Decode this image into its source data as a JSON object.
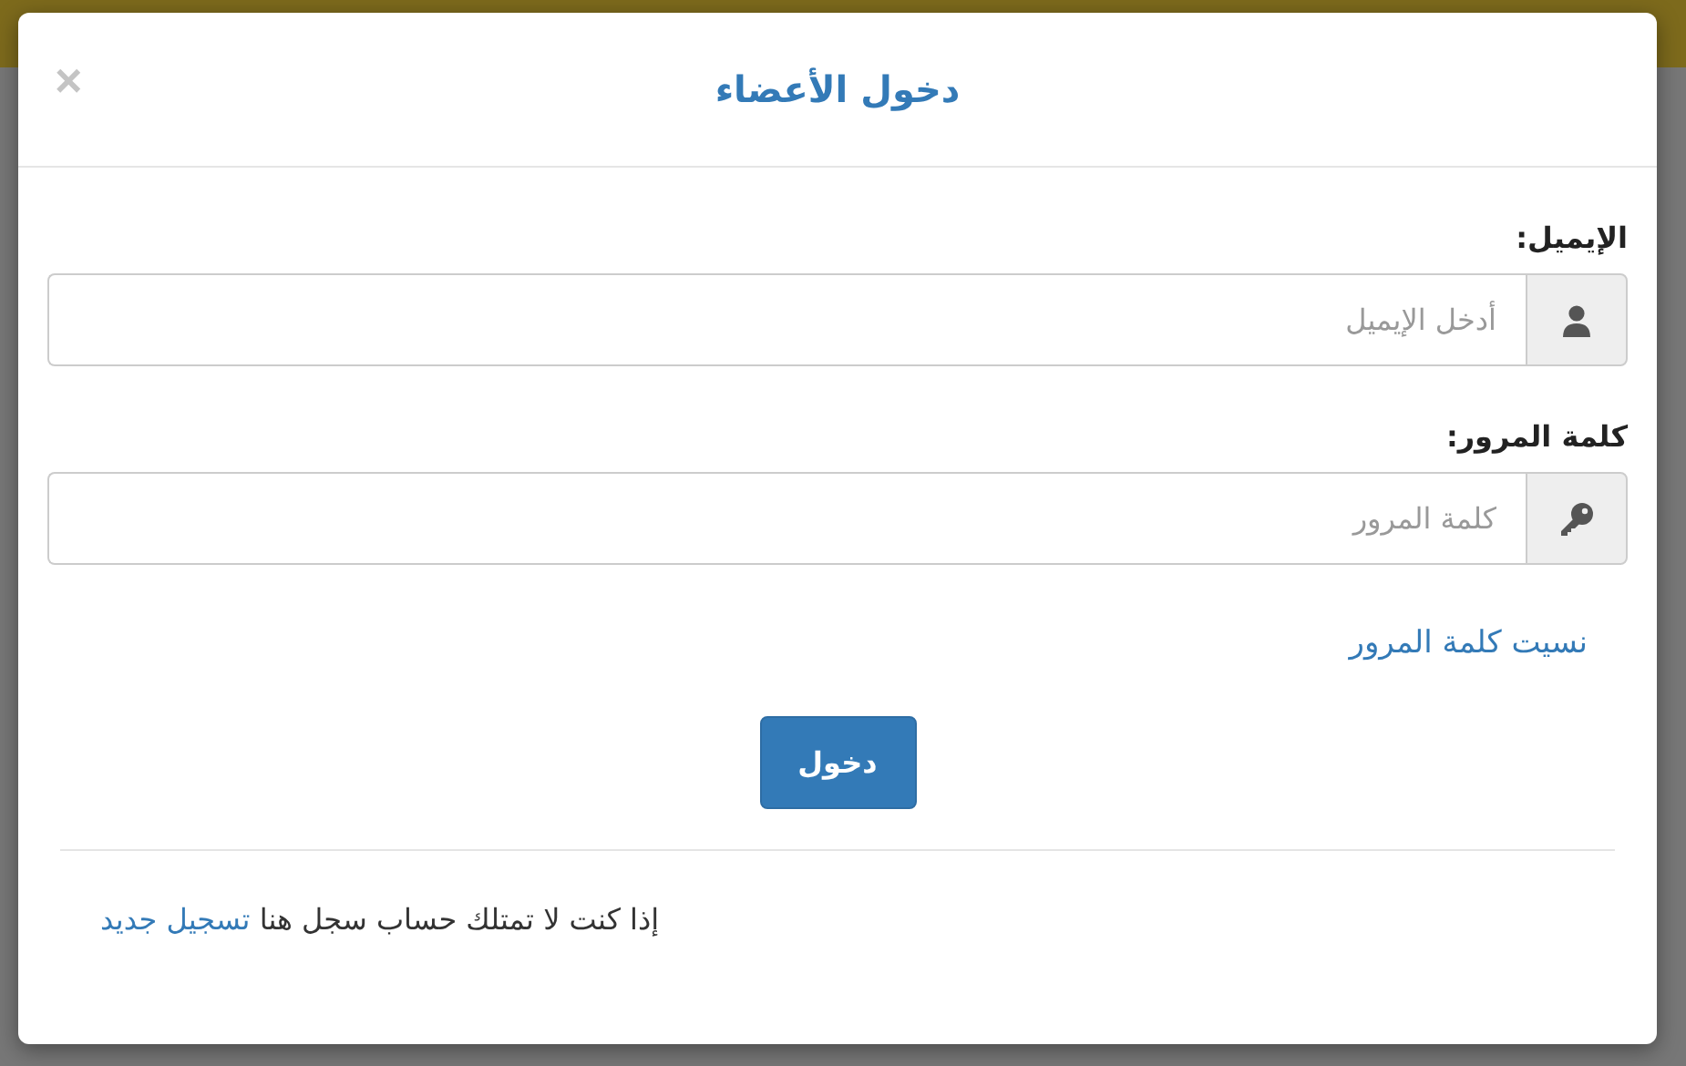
{
  "modal": {
    "title": "دخول الأعضاء",
    "close": "×"
  },
  "fields": [
    {
      "kind": "email",
      "label": "الإيميل:",
      "placeholder": "أدخل الإيميل"
    },
    {
      "kind": "password",
      "label": "كلمة المرور:",
      "placeholder": "كلمة المرور"
    }
  ],
  "forgot_link": "نسيت كلمة المرور",
  "submit_button": "دخول",
  "footer": {
    "text": "إذا كنت لا تمتلك حساب سجل هنا",
    "link": "تسجيل جديد"
  }
}
